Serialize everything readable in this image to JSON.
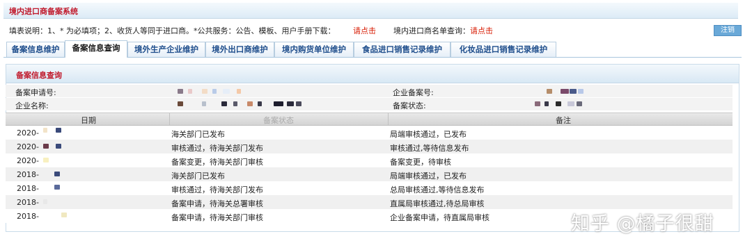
{
  "app": {
    "title": "境内进口商备案系统"
  },
  "info_bar": {
    "instructions": "填表说明：1、* 为必填项；2、收货人等同于进口商。*公共服务：公告、模板、用户手册下载：",
    "click_here_1": "请点击",
    "importer_list_label": "境内进口商名单查询：",
    "click_here_2": "请点击",
    "logout": "注销"
  },
  "tabs": [
    {
      "label": "备案信息维护",
      "active": false
    },
    {
      "label": "备案信息查询",
      "active": true
    },
    {
      "label": "境外生产企业维护",
      "active": false
    },
    {
      "label": "境外出口商维护",
      "active": false
    },
    {
      "label": "境内购货单位维护",
      "active": false
    },
    {
      "label": "食品进口销售记录维护",
      "active": false
    },
    {
      "label": "化妆品进口销售记录维护",
      "active": false
    }
  ],
  "panel": {
    "title": "备案信息查询",
    "fields": {
      "application_no_label": "备案申请号:",
      "company_filing_no_label": "企业备案号:",
      "company_name_label": "企业名称:",
      "filing_status_label": "备案状态:"
    }
  },
  "table": {
    "columns": [
      "日期",
      "备案状态",
      "备注"
    ],
    "rows": [
      {
        "date": "2020-",
        "status": "海关部门已发布",
        "remark": "局端审核通过，已发布"
      },
      {
        "date": "2020-",
        "status": "审核通过，待海关部门发布",
        "remark": "审核通过,等待信息发布"
      },
      {
        "date": "2020-",
        "status": "备案变更，待海关部门审核",
        "remark": "备案变更，待审核"
      },
      {
        "date": "2018-",
        "status": "海关部门已发布",
        "remark": "局端审核通过，已发布"
      },
      {
        "date": "2018-",
        "status": "审核通过，待海关部门发布",
        "remark": "总局审核通过,等待信息发布"
      },
      {
        "date": "2018-",
        "status": "备案申请，待海关总署审核",
        "remark": "直属局审核通过,待总局审核"
      },
      {
        "date": "2018-",
        "status": "备案申请，待海关部门审核",
        "remark": "企业备案申请，待直属局审核"
      }
    ]
  },
  "watermark": "知乎 @橘子很甜",
  "colors": {
    "title_red": "#c0182a",
    "link_red": "#d81e06",
    "tab_blue": "#1f4e8c"
  }
}
